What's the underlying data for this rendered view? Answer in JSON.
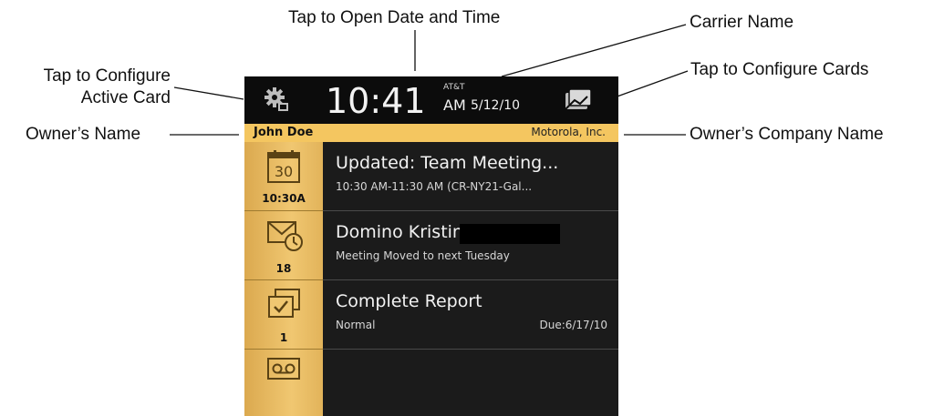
{
  "callouts": {
    "date_time": "Tap to Open Date and Time",
    "carrier": "Carrier Name",
    "configure_active_line1": "Tap to Configure",
    "configure_active_line2": "Active Card",
    "configure_cards": "Tap to Configure Cards",
    "owner_name": "Owner’s Name",
    "owner_company": "Owner’s Company Name"
  },
  "status_bar": {
    "time": "10:41",
    "carrier": "AT&T",
    "ampm": "AM",
    "date": "5/12/10"
  },
  "owner_bar": {
    "name": "John Doe",
    "company": "Motorola, Inc."
  },
  "cards": [
    {
      "icon": "calendar-icon",
      "icon_text": "30",
      "badge": "10:30A",
      "title": "Updated: Team Meeting...",
      "subtitle": "10:30 AM-11:30 AM (CR-NY21-Gal..."
    },
    {
      "icon": "email-clock-icon",
      "badge": "18",
      "title": "Domino Kristin",
      "subtitle": "Meeting Moved to next Tuesday"
    },
    {
      "icon": "tasks-icon",
      "badge": "1",
      "title": "Complete Report",
      "subtitle": "Normal",
      "due": "Due:6/17/10"
    },
    {
      "icon": "voicemail-icon"
    }
  ],
  "colors": {
    "topbar": "#0c0c0c",
    "owner_bar": "#f4c660",
    "card_body": "#1b1b1b",
    "tile_gold": "#f0c771"
  }
}
